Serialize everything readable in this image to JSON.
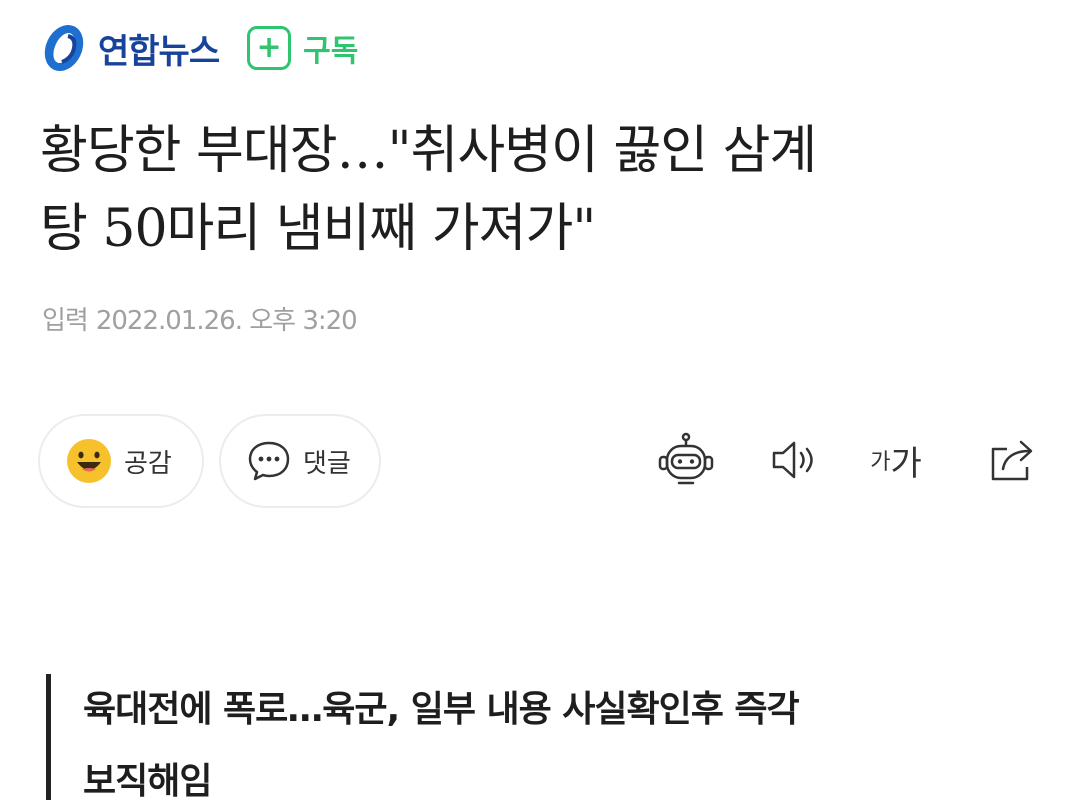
{
  "header": {
    "logo_text": "연합뉴스",
    "subscribe_label": "구독",
    "subscribe_icon": "plus-icon",
    "brand_color": "#17449a",
    "accent_color": "#2fc46f"
  },
  "article": {
    "headline_line1": "황당한 부대장…\"취사병이 끓인 삼계",
    "headline_line2": "탕 50마리 냄비째 가져가\"",
    "date_prefix": "입력",
    "date_value": "2022.01.26. 오후 3:20",
    "subhead_line1": "육대전에 폭로…육군, 일부 내용 사실확인후 즉각",
    "subhead_line2": "보직해임"
  },
  "actions": {
    "empathy_label": "공감",
    "comment_label": "댓글",
    "font_small": "가",
    "font_large": "가"
  },
  "icons": [
    "smile-emoji-icon",
    "speech-bubble-icon",
    "robot-summary-icon",
    "speaker-icon",
    "font-size-icon",
    "share-icon"
  ]
}
